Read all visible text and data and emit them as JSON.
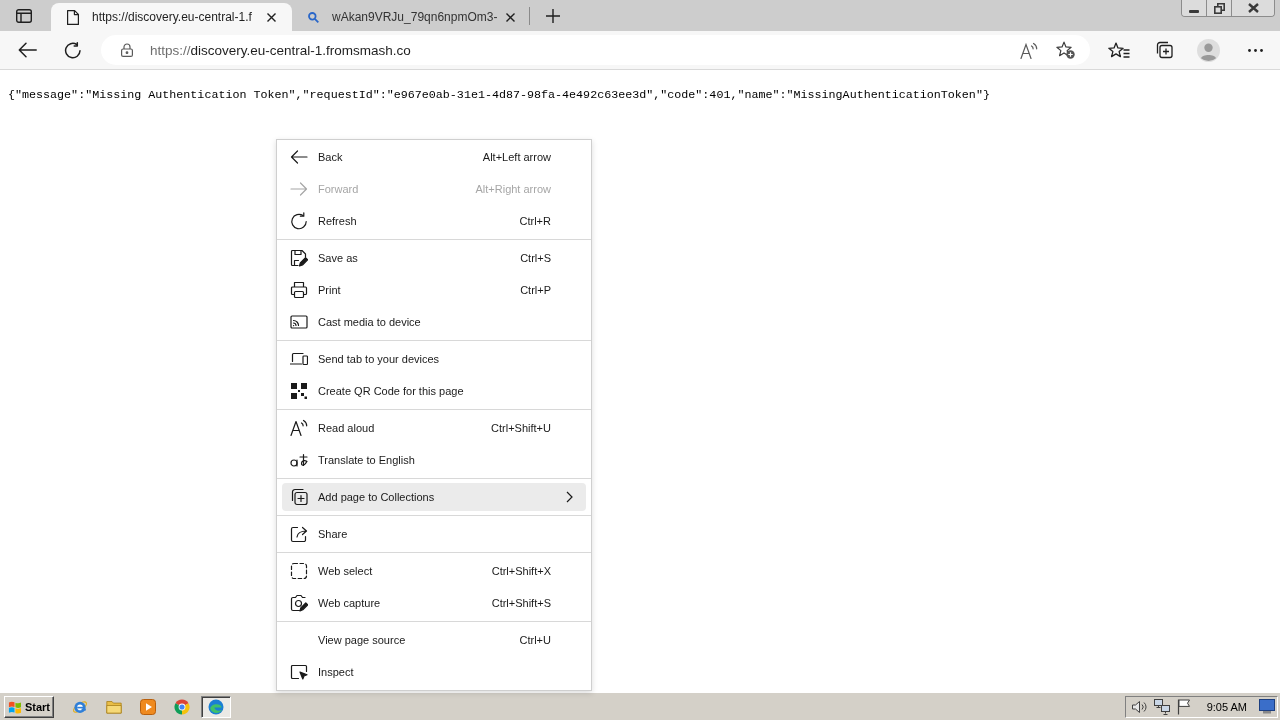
{
  "browser": {
    "tabs": [
      {
        "kind": "page",
        "title": "https://discovery.eu-central-1.f",
        "selected": true
      },
      {
        "kind": "search",
        "title": "wAkan9VRJu_79qn6npmOm3-",
        "selected": false
      }
    ],
    "address_bar": {
      "scheme": "https://",
      "host": "discovery.eu-central-1.fromsmash.co"
    }
  },
  "page": {
    "body_text": "{\"message\":\"Missing Authentication Token\",\"requestId\":\"e967e0ab-31e1-4d87-98fa-4e492c63ee3d\",\"code\":401,\"name\":\"MissingAuthenticationToken\"}"
  },
  "context_menu": {
    "groups": [
      {
        "items": [
          {
            "kind": "back",
            "label": "Back",
            "shortcut": "Alt+Left arrow",
            "disabled": false,
            "highlighted": false,
            "submenu": false
          },
          {
            "kind": "forward",
            "label": "Forward",
            "shortcut": "Alt+Right arrow",
            "disabled": true,
            "highlighted": false,
            "submenu": false
          },
          {
            "kind": "refresh",
            "label": "Refresh",
            "shortcut": "Ctrl+R",
            "disabled": false,
            "highlighted": false,
            "submenu": false
          }
        ]
      },
      {
        "items": [
          {
            "kind": "save",
            "label": "Save as",
            "shortcut": "Ctrl+S",
            "disabled": false,
            "highlighted": false,
            "submenu": false
          },
          {
            "kind": "print",
            "label": "Print",
            "shortcut": "Ctrl+P",
            "disabled": false,
            "highlighted": false,
            "submenu": false
          },
          {
            "kind": "cast",
            "label": "Cast media to device",
            "disabled": false,
            "highlighted": false,
            "submenu": false
          }
        ]
      },
      {
        "items": [
          {
            "kind": "send-tab",
            "label": "Send tab to your devices",
            "disabled": false,
            "highlighted": false,
            "submenu": false
          },
          {
            "kind": "qr",
            "label": "Create QR Code for this page",
            "disabled": false,
            "highlighted": false,
            "submenu": false
          }
        ]
      },
      {
        "items": [
          {
            "kind": "read-aloud",
            "label": "Read aloud",
            "shortcut": "Ctrl+Shift+U",
            "disabled": false,
            "highlighted": false,
            "submenu": false
          },
          {
            "kind": "translate",
            "label": "Translate to English",
            "disabled": false,
            "highlighted": false,
            "submenu": false
          }
        ]
      },
      {
        "items": [
          {
            "kind": "collections",
            "label": "Add page to Collections",
            "disabled": false,
            "highlighted": true,
            "submenu": true
          }
        ]
      },
      {
        "items": [
          {
            "kind": "share",
            "label": "Share",
            "disabled": false,
            "highlighted": false,
            "submenu": false
          }
        ]
      },
      {
        "items": [
          {
            "kind": "web-select",
            "label": "Web select",
            "shortcut": "Ctrl+Shift+X",
            "disabled": false,
            "highlighted": false,
            "submenu": false
          },
          {
            "kind": "web-capture",
            "label": "Web capture",
            "shortcut": "Ctrl+Shift+S",
            "disabled": false,
            "highlighted": false,
            "submenu": false
          }
        ]
      },
      {
        "items": [
          {
            "kind": "plain",
            "label": "View page source",
            "shortcut": "Ctrl+U",
            "disabled": false,
            "highlighted": false,
            "submenu": false
          },
          {
            "kind": "inspect",
            "label": "Inspect",
            "disabled": false,
            "highlighted": false,
            "submenu": false
          }
        ]
      }
    ]
  },
  "taskbar": {
    "start_label": "Start",
    "apps": [
      {
        "kind": "e-globe",
        "selected": false
      },
      {
        "kind": "folder",
        "selected": false
      },
      {
        "kind": "player",
        "selected": false
      },
      {
        "kind": "ring",
        "selected": false
      },
      {
        "kind": "swirl",
        "selected": true
      }
    ],
    "clock": "9:05 AM"
  }
}
